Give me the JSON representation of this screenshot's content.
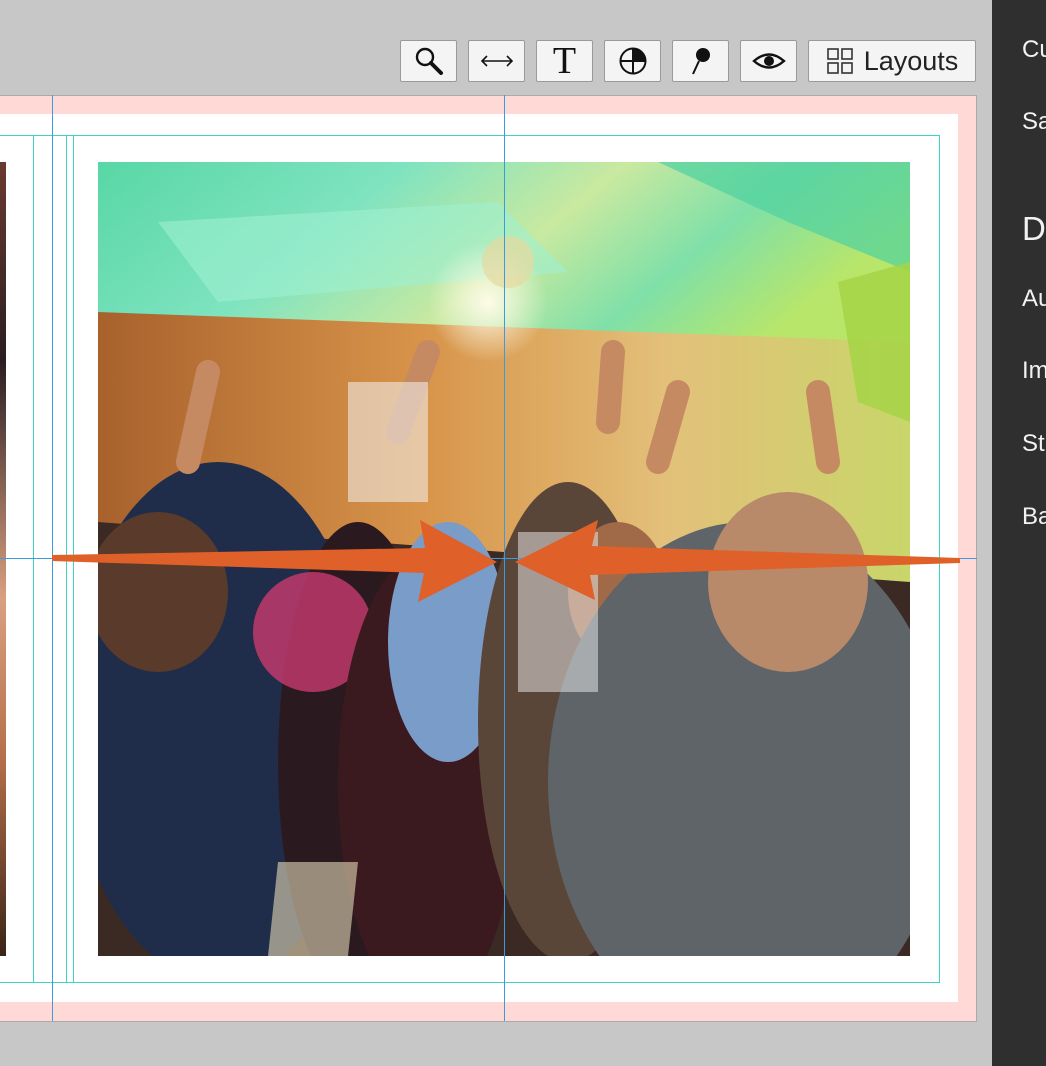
{
  "toolbar": {
    "tools": [
      {
        "name": "zoom-tool",
        "icon": "magnifier-icon"
      },
      {
        "name": "swap-tool",
        "icon": "horizontal-arrows-icon"
      },
      {
        "name": "text-tool",
        "icon": "text-T-icon",
        "glyph": "T"
      },
      {
        "name": "crop-tool",
        "icon": "quartered-circle-icon"
      },
      {
        "name": "pin-tool",
        "icon": "pin-icon"
      },
      {
        "name": "preview-tool",
        "icon": "eye-icon"
      }
    ],
    "layouts_label": "Layouts"
  },
  "right_panel": {
    "items": [
      "Cu",
      "Sa"
    ],
    "heading": "D",
    "sub_items": [
      "Au",
      "Im",
      "St",
      "Ba"
    ]
  },
  "colors": {
    "spread_bleed": "#ffd9d6",
    "guide_teal": "#3fd4c1",
    "guide_blue": "#3b9be0",
    "arrow_orange": "#e0602a",
    "panel_bg": "#2f2f2f",
    "canvas_bg": "#c7c7c7"
  }
}
